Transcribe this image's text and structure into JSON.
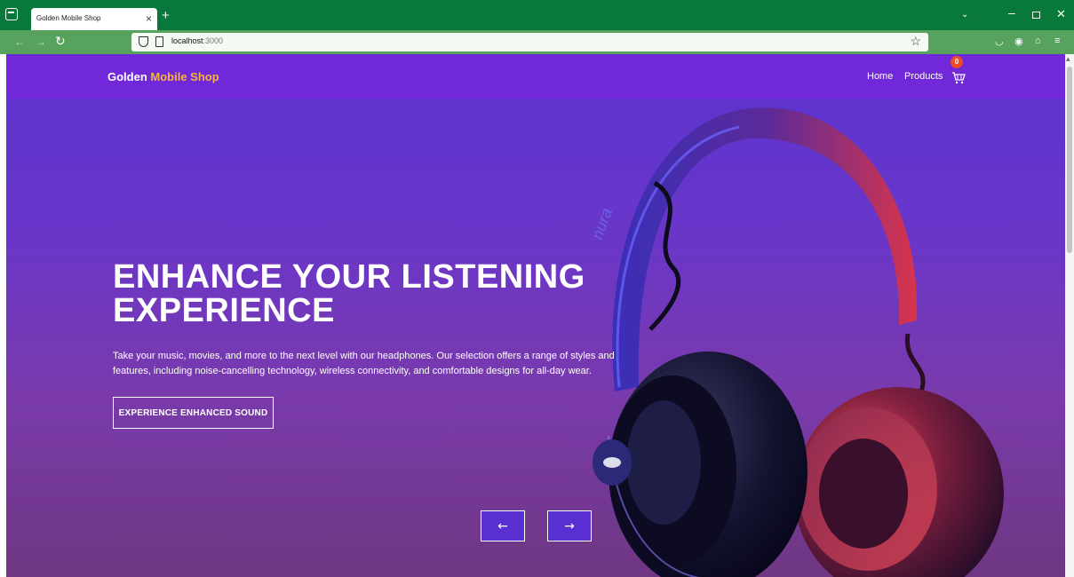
{
  "browser": {
    "tab_title": "Golden Mobile Shop",
    "tab_close": "×",
    "new_tab": "+",
    "url_host": "localhost",
    "url_port": ":3000",
    "bookmark_star": "☆"
  },
  "site": {
    "brand_first": "Golden",
    "brand_second": "Mobile Shop",
    "menu": {
      "home": "Home",
      "products": "Products"
    },
    "cart_count": "0"
  },
  "hero": {
    "title_line1": "ENHANCE YOUR LISTENING",
    "title_line2": "EXPERIENCE",
    "description": "Take your music, movies, and more to the next level with our headphones. Our selection offers a range of styles and features, including noise-cancelling technology, wireless connectivity, and comfortable designs for all-day wear.",
    "cta_label": "EXPERIENCE ENHANCED SOUND",
    "prev_arrow": "←",
    "next_arrow": "→",
    "headphone_brand": "nura"
  },
  "colors": {
    "tabbar": "#08783b",
    "toolbar": "#57a35d",
    "header": "#7028d8",
    "brand_accent": "#f4b63a",
    "badge": "#ec4a2c"
  }
}
